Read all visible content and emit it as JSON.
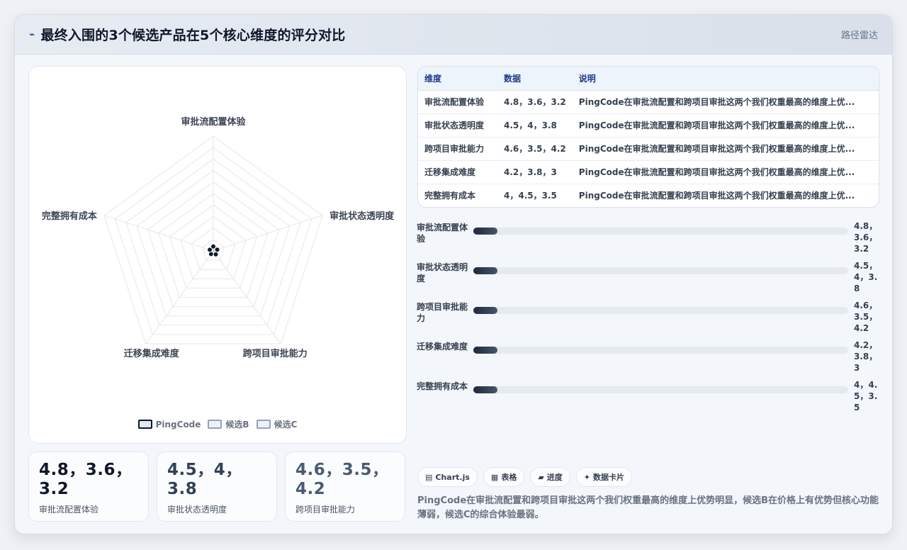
{
  "header": {
    "icon": "pulse-icon",
    "title": "最终入围的3个候选产品在5个核心维度的评分对比",
    "link": "路径雷达"
  },
  "chart_data": {
    "type": "radar",
    "axes": [
      "审批流配置体验",
      "审批状态透明度",
      "跨项目审批能力",
      "迁移集成难度",
      "完整拥有成本"
    ],
    "series": [
      {
        "name": "PingCode",
        "values": [
          4.8,
          4.5,
          4.6,
          4.2,
          4
        ],
        "color": "#0f172a"
      },
      {
        "name": "候选B",
        "values": [
          3.6,
          4,
          3.5,
          3.8,
          4.5
        ],
        "color": "#94a3b8"
      },
      {
        "name": "候选C",
        "values": [
          3.2,
          3.8,
          4.2,
          3,
          3.5
        ],
        "color": "#94a3b8"
      }
    ],
    "max": 5,
    "grid": true,
    "legend_position": "bottom"
  },
  "table": {
    "headers": [
      "维度",
      "数据",
      "说明"
    ],
    "rows": [
      {
        "dim": "审批流配置体验",
        "data": "4.8，3.6，3.2",
        "desc": "PingCode在审批流配置和跨项目审批这两个我们权重最高的维度上优..."
      },
      {
        "dim": "审批状态透明度",
        "data": "4.5，4，3.8",
        "desc": "PingCode在审批流配置和跨项目审批这两个我们权重最高的维度上优..."
      },
      {
        "dim": "跨项目审批能力",
        "data": "4.6，3.5，4.2",
        "desc": "PingCode在审批流配置和跨项目审批这两个我们权重最高的维度上优..."
      },
      {
        "dim": "迁移集成难度",
        "data": "4.2，3.8，3",
        "desc": "PingCode在审批流配置和跨项目审批这两个我们权重最高的维度上优..."
      },
      {
        "dim": "完整拥有成本",
        "data": "4，4.5，3.5",
        "desc": "PingCode在审批流配置和跨项目审批这两个我们权重最高的维度上优..."
      }
    ]
  },
  "bars": [
    {
      "label": "审批流配置体验",
      "value": "4.8，3.6，3.2",
      "fill_fraction": 0.065
    },
    {
      "label": "审批状态透明度",
      "value": "4.5，4，3.8",
      "fill_fraction": 0.065
    },
    {
      "label": "跨项目审批能力",
      "value": "4.6，3.5，4.2",
      "fill_fraction": 0.065
    },
    {
      "label": "迁移集成难度",
      "value": "4.2，3.8，3",
      "fill_fraction": 0.065
    },
    {
      "label": "完整拥有成本",
      "value": "4，4.5，3.5",
      "fill_fraction": 0.065
    }
  ],
  "stats": [
    {
      "value": "4.8，3.6，3.2",
      "label": "审批流配置体验",
      "color": "#0f172a"
    },
    {
      "value": "4.5，4，3.8",
      "label": "审批状态透明度",
      "color": "#334155"
    },
    {
      "value": "4.6，3.5，4.2",
      "label": "跨项目审批能力",
      "color": "#4b5b70"
    }
  ],
  "chips": [
    {
      "icon": "chart-icon",
      "glyph": "▤",
      "label": "Chart.js"
    },
    {
      "icon": "table-icon",
      "glyph": "▦",
      "label": "表格"
    },
    {
      "icon": "progress-icon",
      "glyph": "▰",
      "label": "进度"
    },
    {
      "icon": "sparkle-icon",
      "glyph": "✦",
      "label": "数据卡片"
    }
  ],
  "summary": "PingCode在审批流配置和跨项目审批这两个我们权重最高的维度上优势明显，候选B在价格上有优势但核心功能薄弱，候选C的综合体验最弱。"
}
